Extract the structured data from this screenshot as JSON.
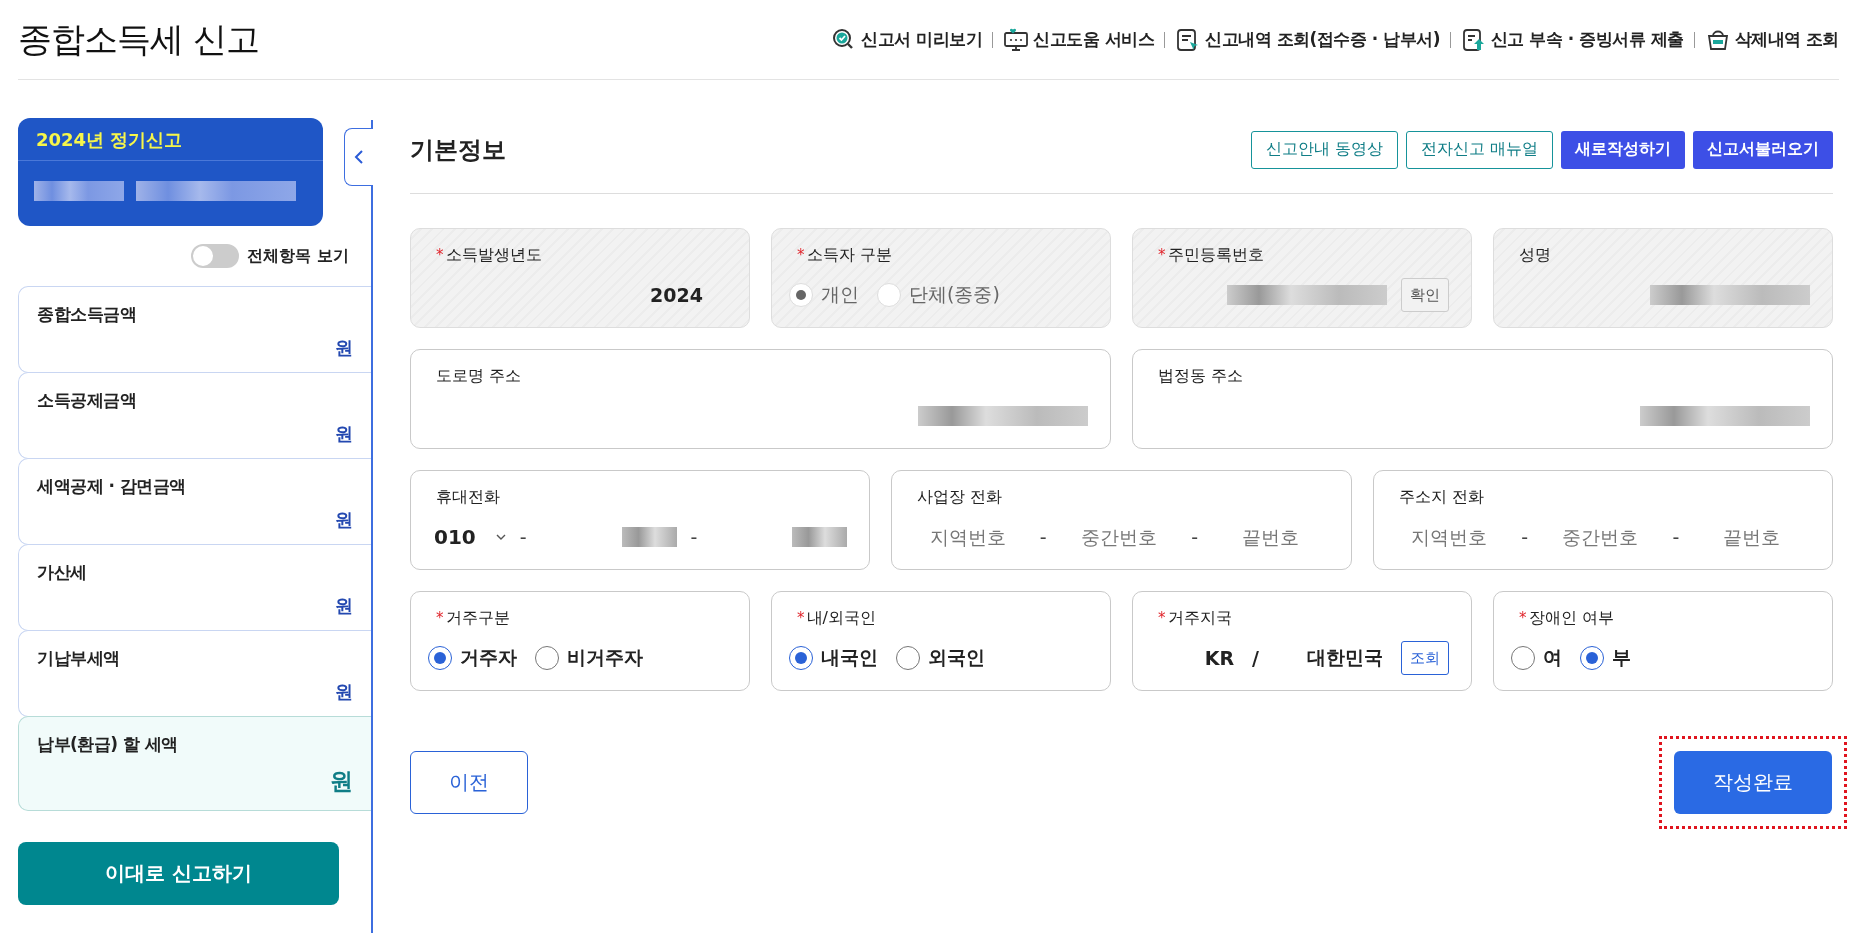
{
  "page_title": "종합소득세 신고",
  "header_links": [
    {
      "label": "신고서 미리보기",
      "kind": "preview"
    },
    {
      "label": "신고도움 서비스",
      "kind": "monitor"
    },
    {
      "label": "신고내역 조회(접수증 · 납부서)",
      "kind": "doc"
    },
    {
      "label": "신고 부속 · 증빙서류 제출",
      "kind": "upload"
    },
    {
      "label": "삭제내역 조회",
      "kind": "basket"
    }
  ],
  "required_mark": "*",
  "sidebar": {
    "card_title": "2024년 정기신고",
    "card_value_hidden": true,
    "toggle": {
      "label": "전체항목 보기",
      "on": false
    },
    "items": [
      {
        "label": "종합소득금액",
        "unit": "원",
        "kind": "normal"
      },
      {
        "label": "소득공제금액",
        "unit": "원",
        "kind": "normal"
      },
      {
        "label": "세액공제 · 감면금액",
        "unit": "원",
        "kind": "normal"
      },
      {
        "label": "가산세",
        "unit": "원",
        "kind": "normal"
      },
      {
        "label": "기납부세액",
        "unit": "원",
        "kind": "normal"
      },
      {
        "label": "납부(환급) 할 세액",
        "unit": "원",
        "kind": "total"
      }
    ],
    "submit_button": "이대로 신고하기"
  },
  "section_title": "기본정보",
  "top_buttons": [
    {
      "label": "신고안내 동영상",
      "kind": "outline"
    },
    {
      "label": "전자신고 매뉴얼",
      "kind": "outline"
    },
    {
      "label": "새로작성하기",
      "kind": "solid"
    },
    {
      "label": "신고서불러오기",
      "kind": "solid"
    }
  ],
  "rows": [
    [
      {
        "label": "소득발생년도",
        "required": true,
        "readonly": true,
        "kind": "text",
        "value": "2024"
      },
      {
        "label": "소득자 구분",
        "required": true,
        "readonly": true,
        "kind": "radio",
        "options": [
          {
            "label": "개인",
            "selected": true
          },
          {
            "label": "단체(종중)",
            "selected": false
          }
        ]
      },
      {
        "label": "주민등록번호",
        "required": true,
        "readonly": true,
        "kind": "text",
        "value_hidden": true,
        "button": "확인"
      },
      {
        "label": "성명",
        "required": false,
        "readonly": true,
        "kind": "text",
        "value_hidden": true
      }
    ],
    [
      {
        "label": "도로명 주소",
        "required": false,
        "readonly": false,
        "kind": "text",
        "value_hidden": true
      },
      {
        "label": "법정동 주소",
        "required": false,
        "readonly": false,
        "kind": "text",
        "value_hidden": true
      }
    ],
    [
      {
        "label": "휴대전화",
        "required": false,
        "readonly": false,
        "kind": "phone",
        "prefix": "010",
        "separator": "-",
        "parts": [
          {
            "value_hidden": true
          },
          {
            "value_hidden": true
          }
        ]
      },
      {
        "label": "사업장 전화",
        "required": false,
        "readonly": false,
        "kind": "phone",
        "separator": "-",
        "parts": [
          {
            "placeholder": "지역번호"
          },
          {
            "placeholder": "중간번호"
          },
          {
            "placeholder": "끝번호"
          }
        ]
      },
      {
        "label": "주소지 전화",
        "required": false,
        "readonly": false,
        "kind": "phone",
        "separator": "-",
        "parts": [
          {
            "placeholder": "지역번호"
          },
          {
            "placeholder": "중간번호"
          },
          {
            "placeholder": "끝번호"
          }
        ]
      }
    ],
    [
      {
        "label": "거주구분",
        "required": true,
        "readonly": false,
        "kind": "radio",
        "options": [
          {
            "label": "거주자",
            "selected": true
          },
          {
            "label": "비거주자",
            "selected": false
          }
        ]
      },
      {
        "label": "내/외국인",
        "required": true,
        "readonly": false,
        "kind": "radio",
        "options": [
          {
            "label": "내국인",
            "selected": true
          },
          {
            "label": "외국인",
            "selected": false
          }
        ]
      },
      {
        "label": "거주지국",
        "required": true,
        "readonly": false,
        "kind": "country",
        "code": "KR",
        "separator": "/",
        "value": "대한민국",
        "button": "조회"
      },
      {
        "label": "장애인 여부",
        "required": true,
        "readonly": false,
        "kind": "radio",
        "options": [
          {
            "label": "여",
            "selected": false
          },
          {
            "label": "부",
            "selected": true
          }
        ]
      }
    ]
  ],
  "prev_button": "이전",
  "complete_button": {
    "label": "작성완료",
    "highlighted": true
  }
}
